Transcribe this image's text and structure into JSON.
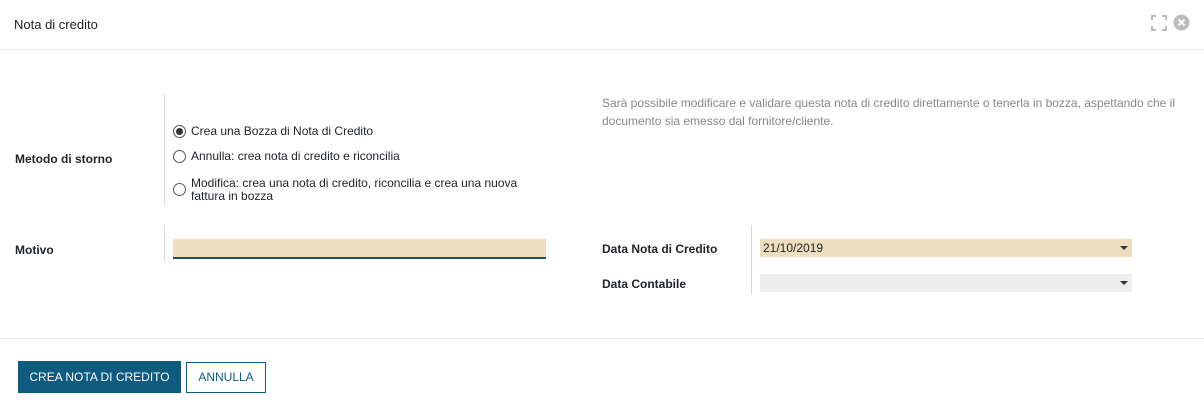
{
  "dialog": {
    "title": "Nota di credito",
    "icons": {
      "expand": "expand-icon",
      "close": "close-circle-icon"
    }
  },
  "form": {
    "metodo_label": "Metodo di storno",
    "radio_options": [
      {
        "label": "Crea una Bozza di Nota di Credito",
        "checked": true
      },
      {
        "label": "Annulla: crea nota di credito e riconcilia",
        "checked": false
      },
      {
        "label": "Modifica: crea una nota di credito, riconcilia e crea una nuova fattura in bozza",
        "checked": false
      }
    ],
    "hint": "Sarà possibile modificare e validare questa nota di credito direttamente o tenerla in bozza, aspettando che il documento sia emesso dal fornitore/cliente.",
    "motivo_label": "Motivo",
    "motivo_value": "",
    "data_nota_label": "Data Nota di Credito",
    "data_nota_value": "21/10/2019",
    "data_contabile_label": "Data Contabile",
    "data_contabile_value": ""
  },
  "footer": {
    "primary_label": "CREA NOTA DI CREDITO",
    "secondary_label": "ANNULLA"
  },
  "colors": {
    "primary": "#0f5a7f",
    "required_field": "#eeddbf",
    "optional_field": "#eeeeee"
  }
}
